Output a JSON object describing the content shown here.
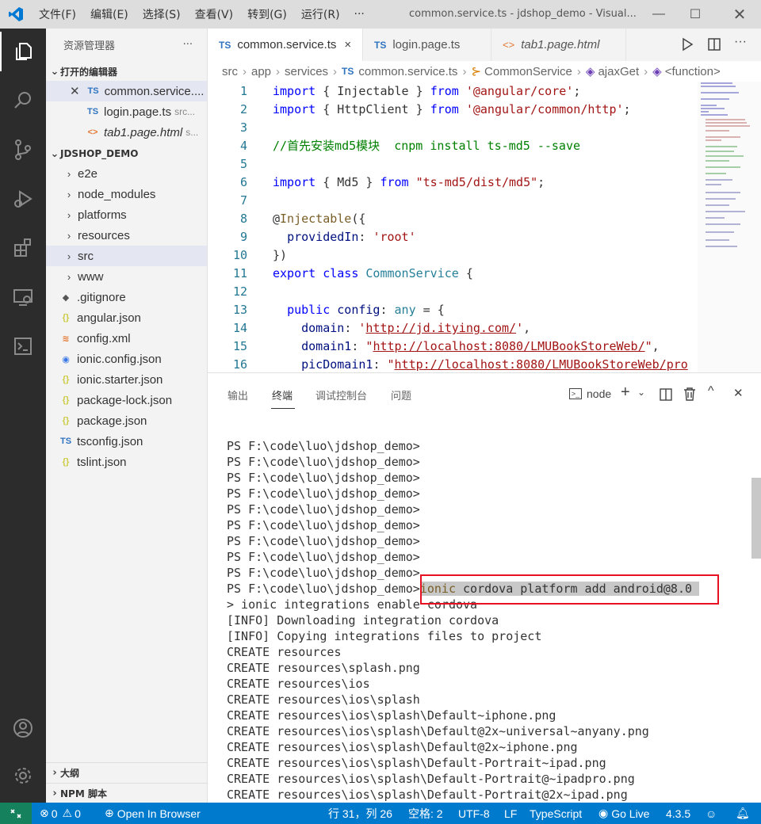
{
  "titlebar": {
    "menu": [
      "文件(F)",
      "编辑(E)",
      "选择(S)",
      "查看(V)",
      "转到(G)",
      "运行(R)",
      "···"
    ],
    "title": "common.service.ts - jdshop_demo - Visual..."
  },
  "sidebar": {
    "title": "资源管理器",
    "more": "···",
    "open_editors": {
      "label": "打开的编辑器",
      "files": [
        {
          "name": "common.service....",
          "badge": "TS",
          "path": ""
        },
        {
          "name": "login.page.ts",
          "badge": "TS",
          "path": "src..."
        },
        {
          "name": "tab1.page.html",
          "badge": "<>",
          "path": "s..."
        }
      ]
    },
    "project": {
      "label": "JDSHOP_DEMO",
      "folders": [
        "e2e",
        "node_modules",
        "platforms",
        "resources",
        "src",
        "www"
      ],
      "files": [
        {
          "name": ".gitignore",
          "icon": "◆"
        },
        {
          "name": "angular.json",
          "icon": "{}"
        },
        {
          "name": "config.xml",
          "icon": "≋"
        },
        {
          "name": "ionic.config.json",
          "icon": "◉"
        },
        {
          "name": "ionic.starter.json",
          "icon": "{}"
        },
        {
          "name": "package-lock.json",
          "icon": "{}"
        },
        {
          "name": "package.json",
          "icon": "{}"
        },
        {
          "name": "tsconfig.json",
          "icon": "TS"
        },
        {
          "name": "tslint.json",
          "icon": "{}"
        }
      ]
    },
    "outline": "大纲",
    "npm": "NPM 脚本"
  },
  "tabs": [
    {
      "label": "common.service.ts",
      "badge": "TS",
      "close": "×"
    },
    {
      "label": "login.page.ts",
      "badge": "TS"
    },
    {
      "label": "tab1.page.html",
      "badge": "<>"
    }
  ],
  "breadcrumbs": [
    "src",
    "app",
    "services",
    "common.service.ts",
    "CommonService",
    "ajaxGet",
    "<function>"
  ],
  "breadcrumb_badge": "TS",
  "code": {
    "line_numbers": [
      "1",
      "2",
      "3",
      "4",
      "5",
      "6",
      "7",
      "8",
      "9",
      "10",
      "11",
      "12",
      "13",
      "14",
      "15",
      "16"
    ],
    "l1": {
      "a": "import",
      "b": " { Injectable } ",
      "c": "from",
      "d": " ",
      "e": "'@angular/core'",
      "f": ";"
    },
    "l2": {
      "a": "import",
      "b": " { HttpClient } ",
      "c": "from",
      "d": " ",
      "e": "'@angular/common/http'",
      "f": ";"
    },
    "l4": "//首先安装md5模块  cnpm install ts-md5 --save",
    "l6": {
      "a": "import",
      "b": " { Md5 } ",
      "c": "from",
      "d": " ",
      "e": "\"ts-md5/dist/md5\"",
      "f": ";"
    },
    "l8": {
      "a": "@",
      "b": "Injectable",
      "c": "({"
    },
    "l9": {
      "a": "  ",
      "b": "providedIn",
      "c": ": ",
      "d": "'root'"
    },
    "l10": "})",
    "l11": {
      "a": "export",
      "b": " ",
      "c": "class",
      "d": " ",
      "e": "CommonService",
      "f": " {"
    },
    "l13": {
      "a": "  ",
      "b": "public",
      "c": " ",
      "d": "config",
      "e": ": ",
      "f": "any",
      "g": " = {"
    },
    "l14": {
      "a": "    ",
      "b": "domain",
      "c": ": ",
      "d": "'",
      "e": "http://jd.itying.com/",
      "f": "'",
      ",": ","
    },
    "l15": {
      "a": "    ",
      "b": "domain1",
      "c": ": ",
      "d": "\"",
      "e": "http://localhost:8080/LMUBookStoreWeb/",
      "f": "\"",
      ",": ","
    },
    "l16": {
      "a": "    ",
      "b": "picDomain1",
      "c": ": ",
      "d": "\"",
      "e": "http://localhost:8080/LMUBookStoreWeb/pro"
    }
  },
  "panel": {
    "tabs": [
      "输出",
      "终端",
      "调试控制台",
      "问题"
    ],
    "active": "终端",
    "terminal_name": "node"
  },
  "terminal": {
    "prompt": "PS F:\\code\\luo\\jdshop_demo>",
    "cmd_head": "ionic",
    "cmd_tail": " cordova platform add android@8.0 ",
    "output": [
      "> ionic integrations enable cordova",
      "[INFO] Downloading integration cordova",
      "[INFO] Copying integrations files to project",
      "CREATE resources",
      "CREATE resources\\splash.png",
      "CREATE resources\\ios",
      "CREATE resources\\ios\\splash",
      "CREATE resources\\ios\\splash\\Default~iphone.png",
      "CREATE resources\\ios\\splash\\Default@2x~universal~anyany.png",
      "CREATE resources\\ios\\splash\\Default@2x~iphone.png",
      "CREATE resources\\ios\\splash\\Default-Portrait~ipad.png",
      "CREATE resources\\ios\\splash\\Default-Portrait@~ipadpro.png",
      "CREATE resources\\ios\\splash\\Default-Portrait@2x~ipad.png"
    ]
  },
  "status": {
    "errors": "0",
    "warnings": "0",
    "open_browser": "Open In Browser",
    "position": "行 31，列 26",
    "spaces": "空格: 2",
    "encoding": "UTF-8",
    "eol": "LF",
    "language": "TypeScript",
    "golive": "Go Live",
    "version": "4.3.5"
  },
  "colors": {
    "accent": "#007acc",
    "activity": "#2c2c2c",
    "highlight_box": "#e81123"
  }
}
